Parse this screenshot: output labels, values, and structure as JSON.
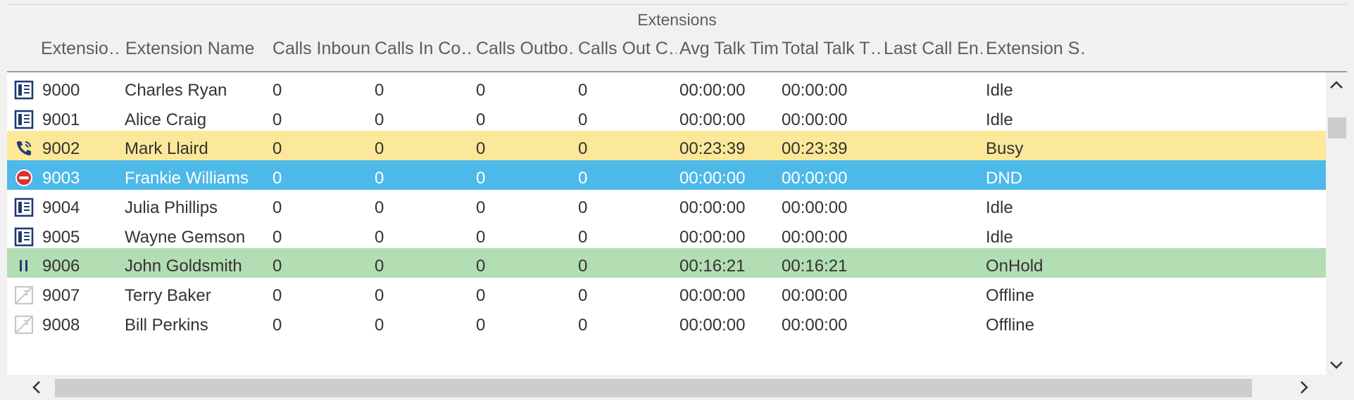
{
  "group_title": "Extensions",
  "columns": [
    "Extensio…",
    "Extension Name",
    "Calls Inbound",
    "Calls In Co…",
    "Calls Outbo…",
    "Calls Out C…",
    "Avg Talk Time",
    "Total Talk T…",
    "Last Call En…",
    "Extension S…"
  ],
  "rows": [
    {
      "status_icon": "phone-idle-icon",
      "ext": "9000",
      "name": "Charles Ryan",
      "calls_inbound": "0",
      "calls_in_co": "0",
      "calls_outbound": "0",
      "calls_out_c": "0",
      "avg_talk": "00:00:00",
      "total_talk": "00:00:00",
      "last_call": "",
      "state": "Idle"
    },
    {
      "status_icon": "phone-idle-icon",
      "ext": "9001",
      "name": "Alice Craig",
      "calls_inbound": "0",
      "calls_in_co": "0",
      "calls_outbound": "0",
      "calls_out_c": "0",
      "avg_talk": "00:00:00",
      "total_talk": "00:00:00",
      "last_call": "",
      "state": "Idle"
    },
    {
      "status_icon": "phone-ringing-icon",
      "ext": "9002",
      "name": "Mark Llaird",
      "calls_inbound": "0",
      "calls_in_co": "0",
      "calls_outbound": "0",
      "calls_out_c": "0",
      "avg_talk": "00:23:39",
      "total_talk": "00:23:39",
      "last_call": "",
      "state": "Busy"
    },
    {
      "status_icon": "do-not-disturb-icon",
      "ext": "9003",
      "name": "Frankie Williams",
      "calls_inbound": "0",
      "calls_in_co": "0",
      "calls_outbound": "0",
      "calls_out_c": "0",
      "avg_talk": "00:00:00",
      "total_talk": "00:00:00",
      "last_call": "",
      "state": "DND"
    },
    {
      "status_icon": "phone-idle-icon",
      "ext": "9004",
      "name": "Julia Phillips",
      "calls_inbound": "0",
      "calls_in_co": "0",
      "calls_outbound": "0",
      "calls_out_c": "0",
      "avg_talk": "00:00:00",
      "total_talk": "00:00:00",
      "last_call": "",
      "state": "Idle"
    },
    {
      "status_icon": "phone-idle-icon",
      "ext": "9005",
      "name": "Wayne Gemson",
      "calls_inbound": "0",
      "calls_in_co": "0",
      "calls_outbound": "0",
      "calls_out_c": "0",
      "avg_talk": "00:00:00",
      "total_talk": "00:00:00",
      "last_call": "",
      "state": "Idle"
    },
    {
      "status_icon": "pause-icon",
      "ext": "9006",
      "name": "John Goldsmith",
      "calls_inbound": "0",
      "calls_in_co": "0",
      "calls_outbound": "0",
      "calls_out_c": "0",
      "avg_talk": "00:16:21",
      "total_talk": "00:16:21",
      "last_call": "",
      "state": "OnHold"
    },
    {
      "status_icon": "phone-offline-icon",
      "ext": "9007",
      "name": "Terry Baker",
      "calls_inbound": "0",
      "calls_in_co": "0",
      "calls_outbound": "0",
      "calls_out_c": "0",
      "avg_talk": "00:00:00",
      "total_talk": "00:00:00",
      "last_call": "",
      "state": "Offline"
    },
    {
      "status_icon": "phone-offline-icon",
      "ext": "9008",
      "name": "Bill Perkins",
      "calls_inbound": "0",
      "calls_in_co": "0",
      "calls_outbound": "0",
      "calls_out_c": "0",
      "avg_talk": "00:00:00",
      "total_talk": "00:00:00",
      "last_call": "",
      "state": "Offline"
    }
  ],
  "colors": {
    "busy_row": "#fbe898",
    "dnd_row": "#4cb9e8",
    "onhold_row": "#b3ddb2",
    "icon_navy": "#1f3a73",
    "dnd_icon_red": "#e03030"
  },
  "scrollbars": {
    "vertical_up": "chevron-up-icon",
    "vertical_down": "chevron-down-icon",
    "horizontal_left": "chevron-left-icon",
    "horizontal_right": "chevron-right-icon"
  }
}
